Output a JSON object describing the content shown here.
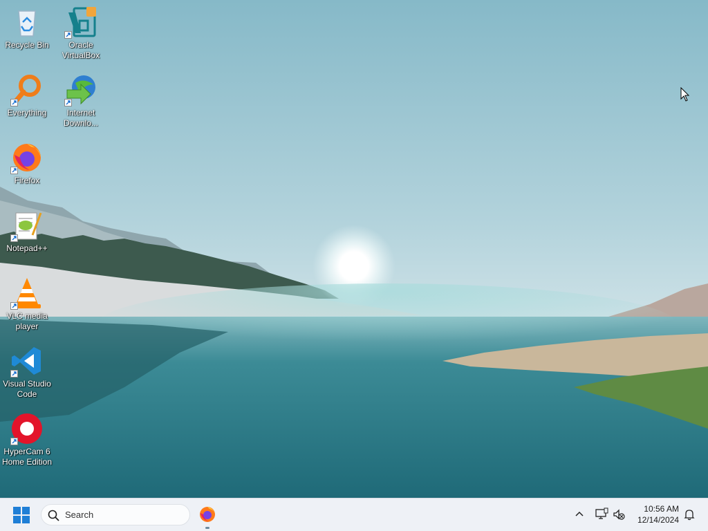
{
  "desktop": {
    "icons": [
      {
        "label": "Recycle Bin",
        "icon": "recycle-bin-icon",
        "shortcut": false
      },
      {
        "label": "Oracle VirtualBox",
        "icon": "virtualbox-icon",
        "shortcut": true
      },
      {
        "label": "Everything",
        "icon": "everything-search-icon",
        "shortcut": true
      },
      {
        "label": "Internet Downlo...",
        "icon": "internet-download-manager-icon",
        "shortcut": true
      },
      {
        "label": "Firefox",
        "icon": "firefox-icon",
        "shortcut": true
      },
      {
        "label": "Notepad++",
        "icon": "notepad-plus-plus-icon",
        "shortcut": true
      },
      {
        "label": "VLC media player",
        "icon": "vlc-icon",
        "shortcut": true
      },
      {
        "label": "Visual Studio Code",
        "icon": "vscode-icon",
        "shortcut": true
      },
      {
        "label": "HyperCam 6 Home Edition",
        "icon": "hypercam-icon",
        "shortcut": true
      }
    ]
  },
  "taskbar": {
    "start_icon": "windows-start-icon",
    "search": {
      "placeholder": "Search",
      "icon": "search-icon"
    },
    "pinned": [
      {
        "name": "Firefox",
        "icon": "firefox-icon",
        "running": true
      }
    ],
    "tray": {
      "overflow_icon": "chevron-up-icon",
      "network_icon": "network-icon",
      "volume_icon": "volume-muted-icon",
      "notification_icon": "bell-icon"
    },
    "clock": {
      "time": "10:56 AM",
      "date": "12/14/2024"
    }
  },
  "colors": {
    "sky_top": "#8fbfcd",
    "lake": "#2f7f8c",
    "taskbar_bg": "#eef1f6",
    "start_blue": "#1f7fd6"
  }
}
